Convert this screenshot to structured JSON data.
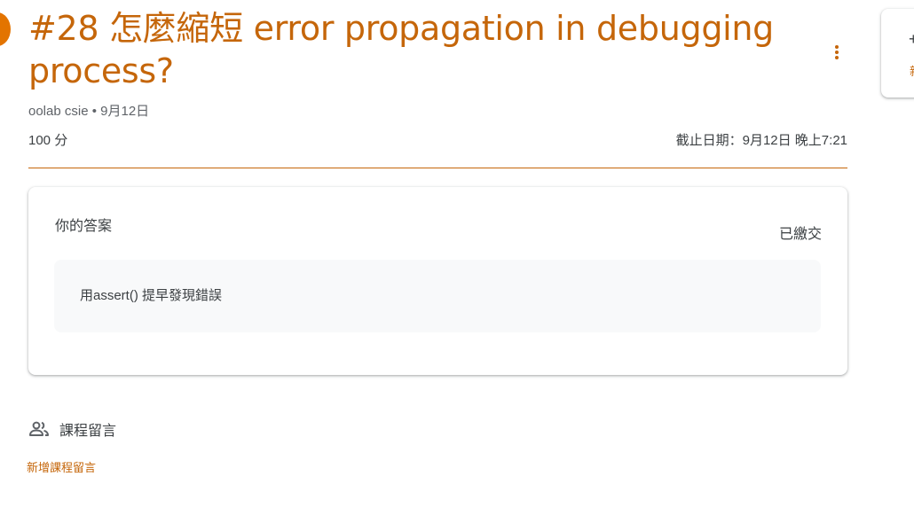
{
  "assignment": {
    "title": "#28 怎麼縮短 error propagation in debugging process?",
    "author": "oolab csie",
    "posted_date": "9月12日",
    "meta_separator": " • ",
    "points": "100 分",
    "due_label": "截止日期：9月12日 晚上7:21"
  },
  "your_work": {
    "heading": "你的答案",
    "status": "已繳交",
    "answer_text": "用assert() 提早發現錯誤"
  },
  "class_comments": {
    "label": "課程留言",
    "add_link": "新增課程留言"
  },
  "side_panel": {
    "glyph": "+",
    "link_text": "新"
  },
  "icons": {
    "more": "more-vert-icon",
    "people": "people-icon",
    "assignment": "assignment-icon"
  },
  "colors": {
    "accent": "#c5660a",
    "assignment_icon": "#e37400",
    "text": "#3c4043",
    "secondary_text": "#5f6368",
    "answer_bg": "#f8f9fa"
  }
}
